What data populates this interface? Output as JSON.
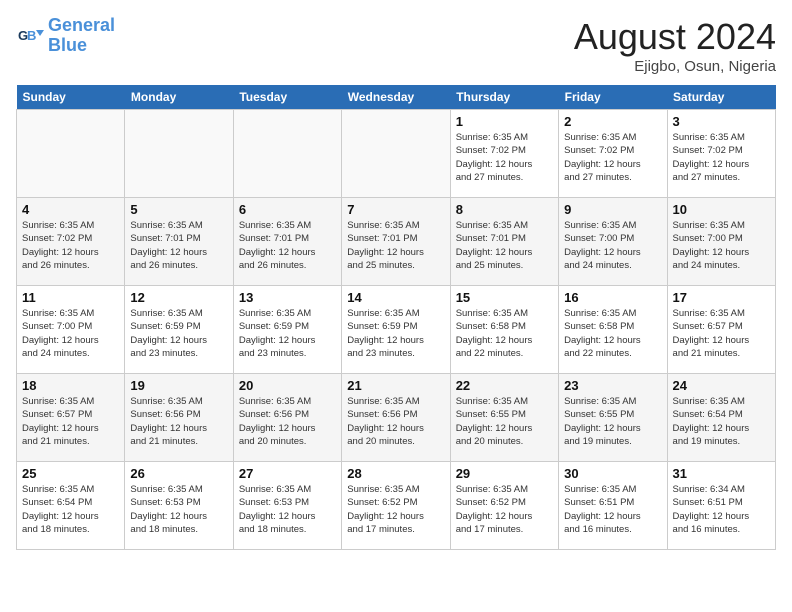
{
  "header": {
    "logo_line1": "General",
    "logo_line2": "Blue",
    "month": "August 2024",
    "location": "Ejigbo, Osun, Nigeria"
  },
  "weekdays": [
    "Sunday",
    "Monday",
    "Tuesday",
    "Wednesday",
    "Thursday",
    "Friday",
    "Saturday"
  ],
  "weeks": [
    [
      {
        "day": "",
        "info": ""
      },
      {
        "day": "",
        "info": ""
      },
      {
        "day": "",
        "info": ""
      },
      {
        "day": "",
        "info": ""
      },
      {
        "day": "1",
        "info": "Sunrise: 6:35 AM\nSunset: 7:02 PM\nDaylight: 12 hours\nand 27 minutes."
      },
      {
        "day": "2",
        "info": "Sunrise: 6:35 AM\nSunset: 7:02 PM\nDaylight: 12 hours\nand 27 minutes."
      },
      {
        "day": "3",
        "info": "Sunrise: 6:35 AM\nSunset: 7:02 PM\nDaylight: 12 hours\nand 27 minutes."
      }
    ],
    [
      {
        "day": "4",
        "info": "Sunrise: 6:35 AM\nSunset: 7:02 PM\nDaylight: 12 hours\nand 26 minutes."
      },
      {
        "day": "5",
        "info": "Sunrise: 6:35 AM\nSunset: 7:01 PM\nDaylight: 12 hours\nand 26 minutes."
      },
      {
        "day": "6",
        "info": "Sunrise: 6:35 AM\nSunset: 7:01 PM\nDaylight: 12 hours\nand 26 minutes."
      },
      {
        "day": "7",
        "info": "Sunrise: 6:35 AM\nSunset: 7:01 PM\nDaylight: 12 hours\nand 25 minutes."
      },
      {
        "day": "8",
        "info": "Sunrise: 6:35 AM\nSunset: 7:01 PM\nDaylight: 12 hours\nand 25 minutes."
      },
      {
        "day": "9",
        "info": "Sunrise: 6:35 AM\nSunset: 7:00 PM\nDaylight: 12 hours\nand 24 minutes."
      },
      {
        "day": "10",
        "info": "Sunrise: 6:35 AM\nSunset: 7:00 PM\nDaylight: 12 hours\nand 24 minutes."
      }
    ],
    [
      {
        "day": "11",
        "info": "Sunrise: 6:35 AM\nSunset: 7:00 PM\nDaylight: 12 hours\nand 24 minutes."
      },
      {
        "day": "12",
        "info": "Sunrise: 6:35 AM\nSunset: 6:59 PM\nDaylight: 12 hours\nand 23 minutes."
      },
      {
        "day": "13",
        "info": "Sunrise: 6:35 AM\nSunset: 6:59 PM\nDaylight: 12 hours\nand 23 minutes."
      },
      {
        "day": "14",
        "info": "Sunrise: 6:35 AM\nSunset: 6:59 PM\nDaylight: 12 hours\nand 23 minutes."
      },
      {
        "day": "15",
        "info": "Sunrise: 6:35 AM\nSunset: 6:58 PM\nDaylight: 12 hours\nand 22 minutes."
      },
      {
        "day": "16",
        "info": "Sunrise: 6:35 AM\nSunset: 6:58 PM\nDaylight: 12 hours\nand 22 minutes."
      },
      {
        "day": "17",
        "info": "Sunrise: 6:35 AM\nSunset: 6:57 PM\nDaylight: 12 hours\nand 21 minutes."
      }
    ],
    [
      {
        "day": "18",
        "info": "Sunrise: 6:35 AM\nSunset: 6:57 PM\nDaylight: 12 hours\nand 21 minutes."
      },
      {
        "day": "19",
        "info": "Sunrise: 6:35 AM\nSunset: 6:56 PM\nDaylight: 12 hours\nand 21 minutes."
      },
      {
        "day": "20",
        "info": "Sunrise: 6:35 AM\nSunset: 6:56 PM\nDaylight: 12 hours\nand 20 minutes."
      },
      {
        "day": "21",
        "info": "Sunrise: 6:35 AM\nSunset: 6:56 PM\nDaylight: 12 hours\nand 20 minutes."
      },
      {
        "day": "22",
        "info": "Sunrise: 6:35 AM\nSunset: 6:55 PM\nDaylight: 12 hours\nand 20 minutes."
      },
      {
        "day": "23",
        "info": "Sunrise: 6:35 AM\nSunset: 6:55 PM\nDaylight: 12 hours\nand 19 minutes."
      },
      {
        "day": "24",
        "info": "Sunrise: 6:35 AM\nSunset: 6:54 PM\nDaylight: 12 hours\nand 19 minutes."
      }
    ],
    [
      {
        "day": "25",
        "info": "Sunrise: 6:35 AM\nSunset: 6:54 PM\nDaylight: 12 hours\nand 18 minutes."
      },
      {
        "day": "26",
        "info": "Sunrise: 6:35 AM\nSunset: 6:53 PM\nDaylight: 12 hours\nand 18 minutes."
      },
      {
        "day": "27",
        "info": "Sunrise: 6:35 AM\nSunset: 6:53 PM\nDaylight: 12 hours\nand 18 minutes."
      },
      {
        "day": "28",
        "info": "Sunrise: 6:35 AM\nSunset: 6:52 PM\nDaylight: 12 hours\nand 17 minutes."
      },
      {
        "day": "29",
        "info": "Sunrise: 6:35 AM\nSunset: 6:52 PM\nDaylight: 12 hours\nand 17 minutes."
      },
      {
        "day": "30",
        "info": "Sunrise: 6:35 AM\nSunset: 6:51 PM\nDaylight: 12 hours\nand 16 minutes."
      },
      {
        "day": "31",
        "info": "Sunrise: 6:34 AM\nSunset: 6:51 PM\nDaylight: 12 hours\nand 16 minutes."
      }
    ]
  ]
}
